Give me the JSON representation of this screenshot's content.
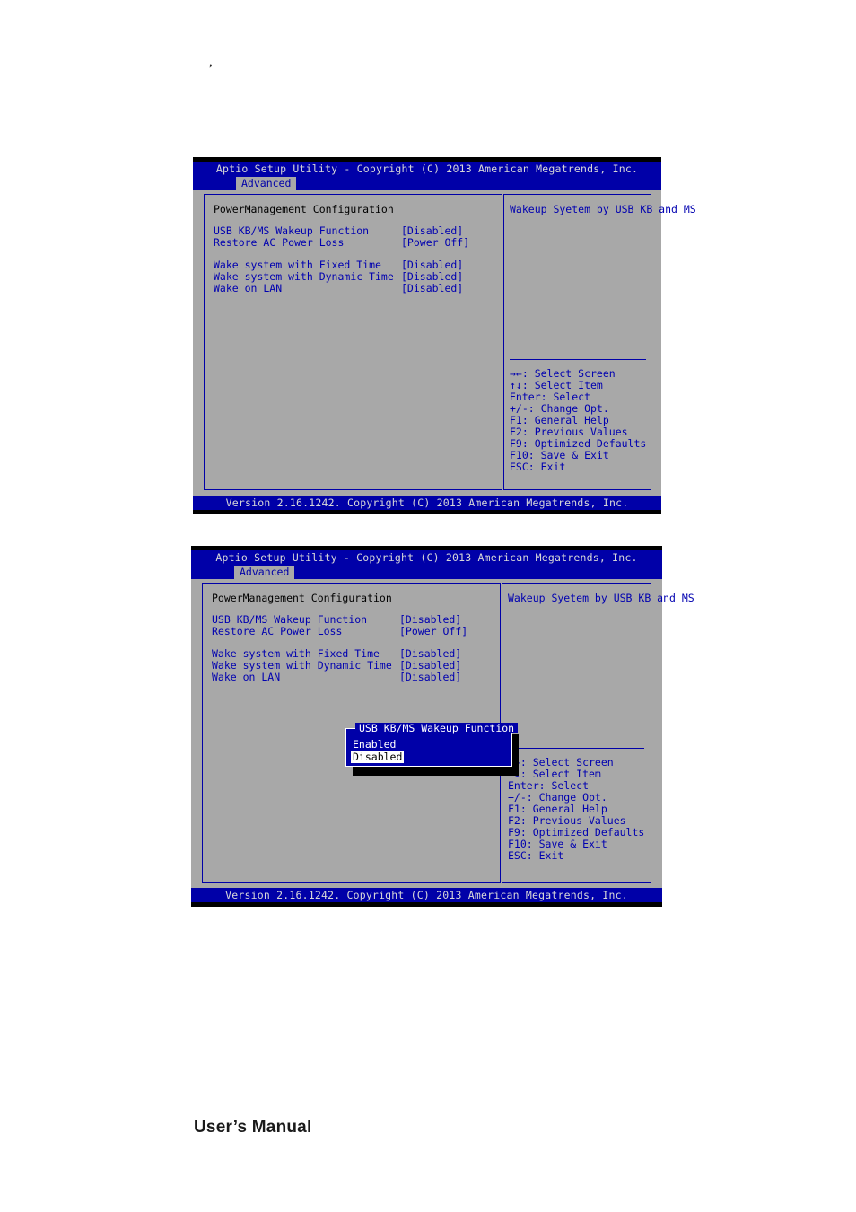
{
  "page": {
    "top_mark": ",",
    "footer_label": "User’s Manual"
  },
  "colors": {
    "bios_blue": "#0000a8",
    "bios_gray": "#a8a8a8",
    "text_blue": "#0000b0",
    "title_text": "#d8d8d8",
    "black": "#000000",
    "white": "#ffffff"
  },
  "screens": [
    {
      "id": "screen-1",
      "title": "Aptio Setup Utility - Copyright (C) 2013 American Megatrends, Inc.",
      "tab": "Advanced",
      "section_title": "PowerManagement Configuration",
      "options": [
        {
          "label": "USB KB/MS Wakeup Function",
          "value": "[Disabled]"
        },
        {
          "label": "Restore AC Power Loss",
          "value": "[Power Off]"
        },
        {
          "label": "Wake system with Fixed Time",
          "value": "[Disabled]"
        },
        {
          "label": "Wake system with Dynamic Time",
          "value": "[Disabled]"
        },
        {
          "label": "Wake on LAN",
          "value": "[Disabled]"
        }
      ],
      "help_text": "Wakeup Syetem by USB KB and MS",
      "keys": [
        "→←: Select Screen",
        "↑↓: Select Item",
        "Enter: Select",
        "+/-: Change Opt.",
        "F1: General Help",
        "F2: Previous Values",
        "F9: Optimized Defaults",
        "F10: Save & Exit",
        "ESC: Exit"
      ],
      "footer": "Version 2.16.1242. Copyright (C) 2013 American Megatrends, Inc.",
      "popup": null
    },
    {
      "id": "screen-2",
      "title": "Aptio Setup Utility - Copyright (C) 2013 American Megatrends, Inc.",
      "tab": "Advanced",
      "section_title": "PowerManagement Configuration",
      "options": [
        {
          "label": "USB KB/MS Wakeup Function",
          "value": "[Disabled]"
        },
        {
          "label": "Restore AC Power Loss",
          "value": "[Power Off]"
        },
        {
          "label": "Wake system with Fixed Time",
          "value": "[Disabled]"
        },
        {
          "label": "Wake system with Dynamic Time",
          "value": "[Disabled]"
        },
        {
          "label": "Wake on LAN",
          "value": "[Disabled]"
        }
      ],
      "help_text": "Wakeup Syetem by USB KB and MS",
      "keys": [
        "→←: Select Screen",
        "↑↓: Select Item",
        "Enter: Select",
        "+/-: Change Opt.",
        "F1: General Help",
        "F2: Previous Values",
        "F9: Optimized Defaults",
        "F10: Save & Exit",
        "ESC: Exit"
      ],
      "footer": "Version 2.16.1242. Copyright (C) 2013 American Megatrends, Inc.",
      "popup": {
        "title": "USB KB/MS Wakeup Function",
        "options": [
          {
            "label": "Enabled",
            "selected": false
          },
          {
            "label": "Disabled",
            "selected": true
          }
        ]
      }
    }
  ]
}
